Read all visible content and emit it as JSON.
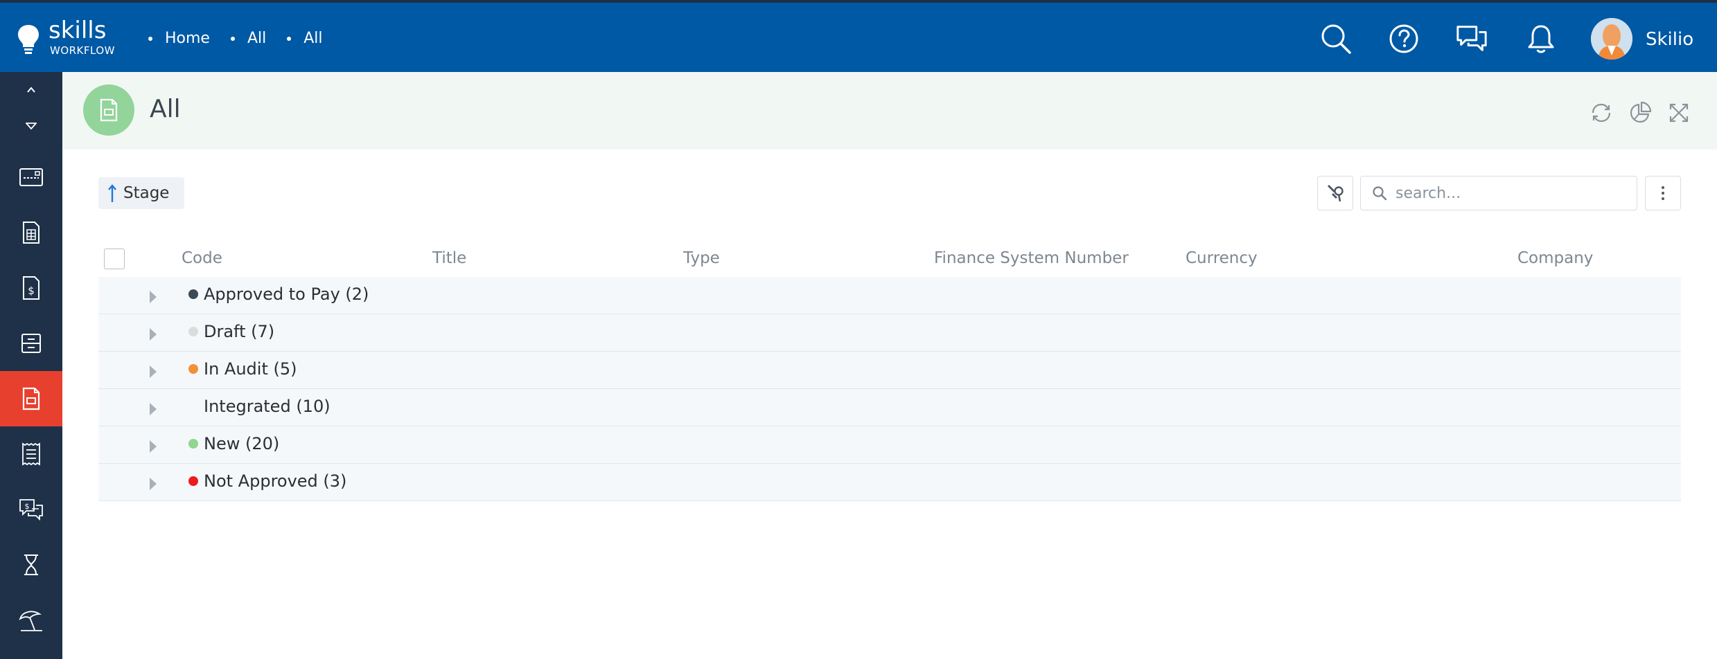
{
  "app": {
    "logo_word1": "skills",
    "logo_word2": "WORKFLOW",
    "breadcrumbs": [
      "Home",
      "All",
      "All"
    ],
    "user_name": "Skilio",
    "top_icons": [
      "search-icon",
      "help-icon",
      "chat-icon",
      "bell-icon"
    ]
  },
  "sidebar": {
    "items": [
      "dashboard-icon",
      "calculator-icon",
      "invoice-icon",
      "archive-icon",
      "document-icon",
      "receipt-icon",
      "money-chat-icon",
      "hourglass-icon",
      "beach-umbrella-icon"
    ],
    "active_index": 4
  },
  "header": {
    "title": "All",
    "tools": [
      "refresh-icon",
      "pie-chart-icon",
      "expand-icon"
    ]
  },
  "toolbar": {
    "group_label": "Stage",
    "search_placeholder": "search..."
  },
  "table": {
    "columns": [
      "Code",
      "Title",
      "Type",
      "Finance System Number",
      "Currency",
      "Company"
    ],
    "groups": [
      {
        "label": "Approved to Pay (2)",
        "color": "#3b4a55"
      },
      {
        "label": "Draft (7)",
        "color": "#dcdcdc"
      },
      {
        "label": "In Audit (5)",
        "color": "#f0913a"
      },
      {
        "label": "Integrated (10)",
        "color": ""
      },
      {
        "label": "New (20)",
        "color": "#8fd68e"
      },
      {
        "label": "Not Approved (3)",
        "color": "#ee1b1b"
      }
    ]
  },
  "colors": {
    "topbar": "#0059a5",
    "sidebar": "#1e3148",
    "sidebar_active": "#e8402f",
    "header_band": "#f1f8f3",
    "page_icon_bg": "#93d49a"
  }
}
